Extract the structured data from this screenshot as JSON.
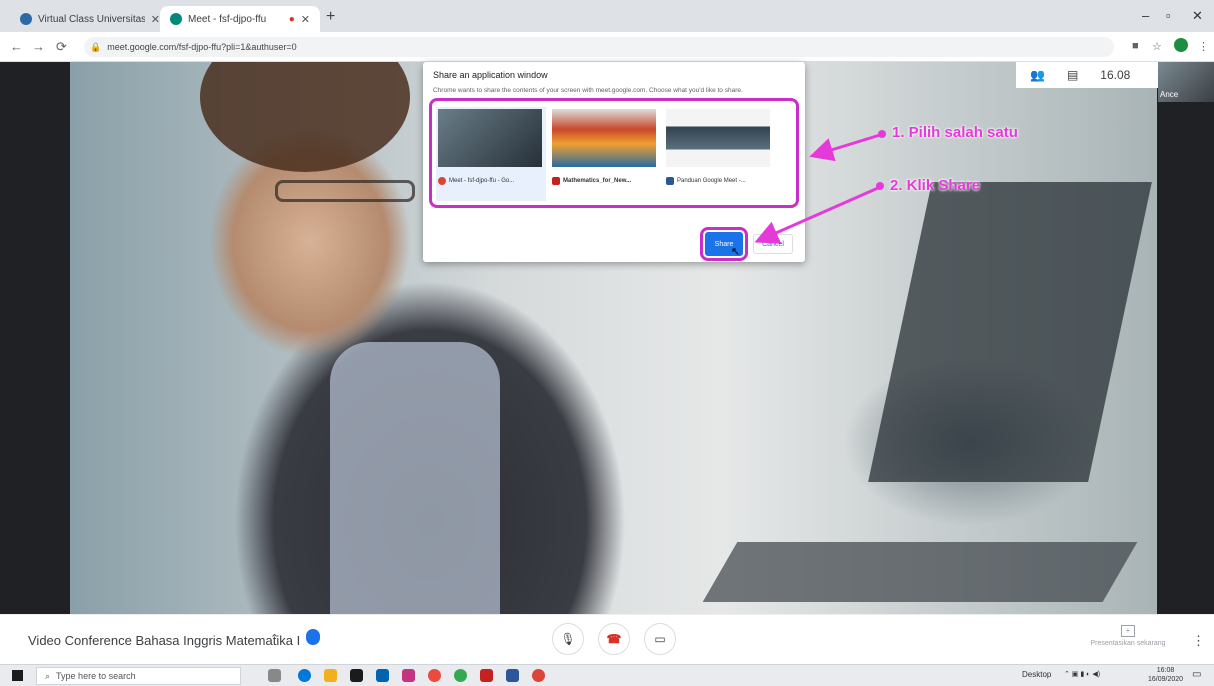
{
  "browser": {
    "tabs": [
      {
        "title": "Virtual Class Universitas Malikus..."
      },
      {
        "title": "Meet - fsf-djpo-ffu"
      }
    ],
    "url": "meet.google.com/fsf-djpo-ffu?pli=1&authuser=0"
  },
  "meet": {
    "time": "16.08",
    "self_label": "Ance",
    "meeting_name": "Video Conference Bahasa Inggris Matematika I",
    "present_label": "Presentasikan sekarang"
  },
  "dialog": {
    "title": "Share an application window",
    "description": "Chrome wants to share the contents of your screen with meet.google.com. Choose what you'd like to share.",
    "windows": [
      {
        "label": "Meet - fsf-djpo-ffu - Go..."
      },
      {
        "label": "Mathematics_for_New..."
      },
      {
        "label": "Panduan Google Meet -..."
      }
    ],
    "share_label": "Share",
    "cancel_label": "Cancel"
  },
  "annotations": {
    "step1": "1. Pilih salah satu",
    "step2": "2. Klik Share"
  },
  "taskbar": {
    "search_placeholder": "Type here to search",
    "desktop_label": "Desktop",
    "time": "16:08",
    "date": "16/09/2020"
  },
  "colors": {
    "annotation": "#e53ad9",
    "accent": "#1a73e8"
  }
}
